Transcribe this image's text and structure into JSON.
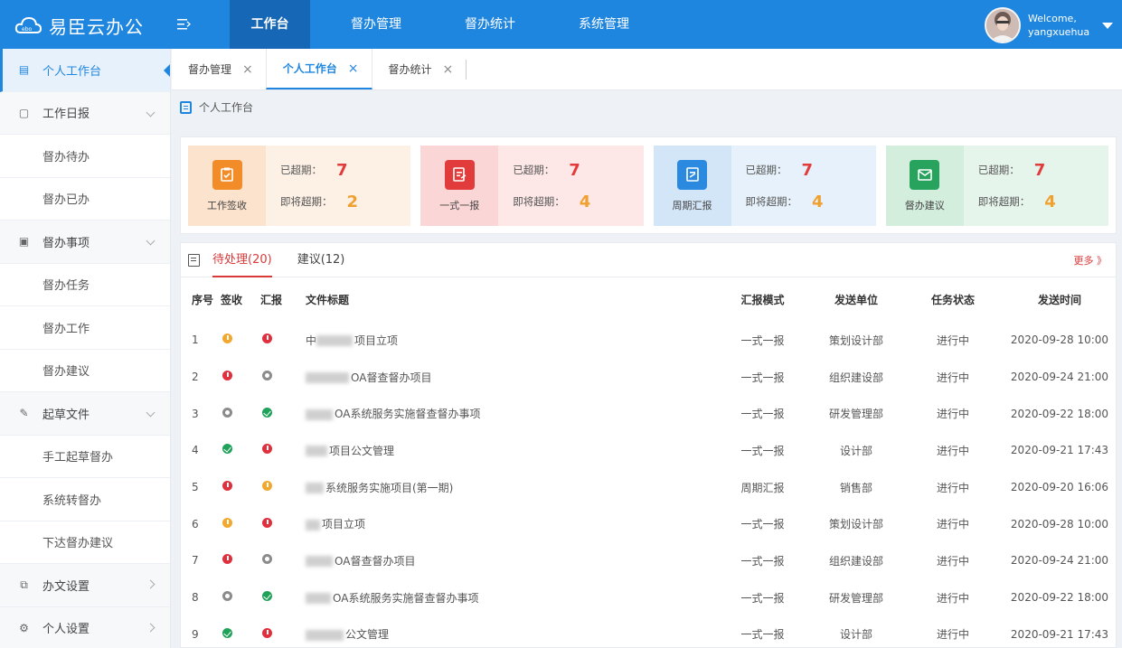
{
  "app": {
    "logo_text": "易臣云办公"
  },
  "nav": {
    "items": [
      {
        "label": "工作台",
        "active": true
      },
      {
        "label": "督办管理"
      },
      {
        "label": "督办统计"
      },
      {
        "label": "系统管理"
      }
    ]
  },
  "user": {
    "welcome": "Welcome,",
    "name": "yangxuehua"
  },
  "sidebar": {
    "items": [
      {
        "label": "个人工作台",
        "icon": "document-icon",
        "type": "active"
      },
      {
        "label": "工作日报",
        "icon": "calendar-icon",
        "type": "group",
        "chevron": "down"
      },
      {
        "label": "督办待办",
        "type": "sub"
      },
      {
        "label": "督办已办",
        "type": "sub"
      },
      {
        "label": "督办事项",
        "icon": "list-icon",
        "type": "group",
        "chevron": "down"
      },
      {
        "label": "督办任务",
        "type": "sub"
      },
      {
        "label": "督办工作",
        "type": "sub"
      },
      {
        "label": "督办建议",
        "type": "sub"
      },
      {
        "label": "起草文件",
        "icon": "edit-icon",
        "type": "group",
        "chevron": "down"
      },
      {
        "label": "手工起草督办",
        "type": "sub"
      },
      {
        "label": "系统转督办",
        "type": "sub"
      },
      {
        "label": "下达督办建议",
        "type": "sub"
      },
      {
        "label": "办文设置",
        "icon": "doc-settings-icon",
        "type": "group",
        "chevron": "right"
      },
      {
        "label": "个人设置",
        "icon": "gear-icon",
        "type": "group",
        "chevron": "right"
      }
    ]
  },
  "tabs": [
    {
      "label": "督办管理",
      "close": "×"
    },
    {
      "label": "个人工作台",
      "close": "×",
      "active": true
    },
    {
      "label": "督办统计",
      "close": "×"
    }
  ],
  "breadcrumb": "个人工作台",
  "cards": [
    {
      "label": "工作签收",
      "overdue_label": "已超期：",
      "overdue": "7",
      "soon_label": "即将超期：",
      "soon": "2",
      "bg": "#fdf0e4",
      "left_bg": "#fbe3cd",
      "icon_color": "#f28c28"
    },
    {
      "label": "一式一报",
      "overdue_label": "已超期：",
      "overdue": "7",
      "soon_label": "即将超期：",
      "soon": "4",
      "bg": "#fde7e7",
      "left_bg": "#fbd6d6",
      "icon_color": "#e23b3b"
    },
    {
      "label": "周期汇报",
      "overdue_label": "已超期：",
      "overdue": "7",
      "soon_label": "即将超期：",
      "soon": "4",
      "bg": "#e6f1fb",
      "left_bg": "#d3e6f8",
      "icon_color": "#2b8ae0"
    },
    {
      "label": "督办建议",
      "overdue_label": "已超期：",
      "overdue": "7",
      "soon_label": "即将超期：",
      "soon": "4",
      "bg": "#e6f5ec",
      "left_bg": "#d3eedd",
      "icon_color": "#27a35e"
    }
  ],
  "panel": {
    "tabs": [
      {
        "label": "待处理(20)",
        "active": true
      },
      {
        "label": "建议(12)"
      }
    ],
    "more": "更多 》",
    "columns": [
      "序号",
      "签收",
      "汇报",
      "文件标题",
      "汇报模式",
      "发送单位",
      "任务状态",
      "发送时间"
    ],
    "rows": [
      {
        "no": "1",
        "sign": "orange",
        "report": "red",
        "title_prefix": "中",
        "title": "项目立项",
        "mode": "一式一报",
        "dept": "策划设计部",
        "status": "进行中",
        "time": "2020-09-28 10:00"
      },
      {
        "no": "2",
        "sign": "red",
        "report": "gray",
        "title_prefix": "",
        "title": "OA督查督办项目",
        "mode": "一式一报",
        "dept": "组织建设部",
        "status": "进行中",
        "time": "2020-09-24 21:00"
      },
      {
        "no": "3",
        "sign": "gray",
        "report": "green",
        "title_prefix": "",
        "title": "OA系统服务实施督查督办事项",
        "mode": "一式一报",
        "dept": "研发管理部",
        "status": "进行中",
        "time": "2020-09-22 18:00"
      },
      {
        "no": "4",
        "sign": "green",
        "report": "red",
        "title_prefix": "",
        "title": "项目公文管理",
        "mode": "一式一报",
        "dept": "设计部",
        "status": "进行中",
        "time": "2020-09-21 17:43"
      },
      {
        "no": "5",
        "sign": "red",
        "report": "orange",
        "title_prefix": "",
        "title": "系统服务实施项目(第一期)",
        "mode": "周期汇报",
        "dept": "销售部",
        "status": "进行中",
        "time": "2020-09-20 16:06"
      },
      {
        "no": "6",
        "sign": "orange",
        "report": "red",
        "title_prefix": "",
        "title": "项目立项",
        "mode": "一式一报",
        "dept": "策划设计部",
        "status": "进行中",
        "time": "2020-09-28 10:00"
      },
      {
        "no": "7",
        "sign": "red",
        "report": "gray",
        "title_prefix": "",
        "title": "OA督查督办项目",
        "mode": "一式一报",
        "dept": "组织建设部",
        "status": "进行中",
        "time": "2020-09-24 21:00"
      },
      {
        "no": "8",
        "sign": "gray",
        "report": "green",
        "title_prefix": "",
        "title": "OA系统服务实施督查督办事项",
        "mode": "一式一报",
        "dept": "研发管理部",
        "status": "进行中",
        "time": "2020-09-22 18:00"
      },
      {
        "no": "9",
        "sign": "green",
        "report": "red",
        "title_prefix": "",
        "title": "公文管理",
        "mode": "一式一报",
        "dept": "设计部",
        "status": "进行中",
        "time": "2020-09-21 17:43"
      }
    ]
  }
}
